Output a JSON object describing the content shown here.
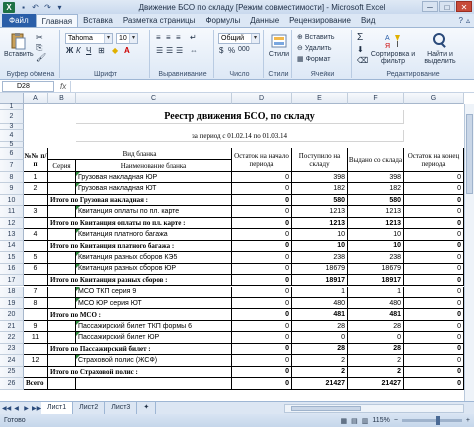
{
  "window": {
    "title": "Движение БСО по складу  [Режим совместимости]  -  Microsoft Excel",
    "app_icon": "X",
    "buttons": [
      "─",
      "□",
      "✕"
    ]
  },
  "ribbon_tabs": {
    "file": "Файл",
    "tabs": [
      "Главная",
      "Вставка",
      "Разметка страницы",
      "Формулы",
      "Данные",
      "Рецензирование",
      "Вид"
    ]
  },
  "ribbon": {
    "clipboard": {
      "paste": "Вставить",
      "label": "Буфер обмена"
    },
    "font": {
      "name": "Tahoma",
      "size": "10",
      "label": "Шрифт",
      "bold": "Ж",
      "italic": "К",
      "underline": "Ч"
    },
    "alignment": {
      "label": "Выравнивание"
    },
    "number": {
      "format": "Общий",
      "label": "Число",
      "percent": "%",
      "thousands": "000"
    },
    "styles": {
      "label": "Стили",
      "button": "Стили"
    },
    "cells": {
      "insert": "Вставить",
      "delete": "Удалить",
      "format": "Формат",
      "label": "Ячейки"
    },
    "editing": {
      "sum": "Σ",
      "sort": "Сортировка и фильтр",
      "find": "Найти и выделить",
      "label": "Редактирование"
    }
  },
  "formula_bar": {
    "name_box": "D28",
    "fx": "fx",
    "content": ""
  },
  "columns": [
    "A",
    "B",
    "C",
    "D",
    "E",
    "F",
    "G"
  ],
  "rows": [
    {
      "n": "1",
      "cells": []
    },
    {
      "n": "2",
      "cells": [
        {
          "col": "C",
          "span": 4,
          "text": "Реестр движения БСО, по складу",
          "cls": "bold c serif big"
        }
      ]
    },
    {
      "n": "3",
      "cells": []
    },
    {
      "n": "4",
      "cells": [
        {
          "col": "C",
          "span": 4,
          "text": "за период с 01.02.14 по 01.03.14",
          "cls": "c serif"
        }
      ]
    },
    {
      "n": "5",
      "cells": []
    },
    {
      "n": "6",
      "cells": []
    },
    {
      "n": "7",
      "cells": []
    },
    {
      "n": "8",
      "cells": [
        {
          "col": "A",
          "text": "1",
          "cls": "c"
        },
        {
          "col": "C",
          "text": "Грузовая накладная ЮР",
          "cls": "l",
          "tri": true
        },
        {
          "col": "D",
          "text": "0",
          "cls": "r"
        },
        {
          "col": "E",
          "text": "398",
          "cls": "r"
        },
        {
          "col": "F",
          "text": "398",
          "cls": "r"
        },
        {
          "col": "G",
          "text": "0",
          "cls": "r"
        }
      ]
    },
    {
      "n": "9",
      "cells": [
        {
          "col": "A",
          "text": "2",
          "cls": "c"
        },
        {
          "col": "C",
          "text": "Грузовая накладная ЮТ",
          "cls": "l",
          "tri": true
        },
        {
          "col": "D",
          "text": "0",
          "cls": "r"
        },
        {
          "col": "E",
          "text": "182",
          "cls": "r"
        },
        {
          "col": "F",
          "text": "182",
          "cls": "r"
        },
        {
          "col": "G",
          "text": "0",
          "cls": "r"
        }
      ]
    },
    {
      "n": "10",
      "cells": [
        {
          "col": "B",
          "span": 2,
          "text": "Итого по Грузовая накладная :",
          "cls": "bold l serif"
        },
        {
          "col": "D",
          "text": "0",
          "cls": "r bold"
        },
        {
          "col": "E",
          "text": "580",
          "cls": "r bold"
        },
        {
          "col": "F",
          "text": "580",
          "cls": "r bold"
        },
        {
          "col": "G",
          "text": "0",
          "cls": "r bold"
        }
      ]
    },
    {
      "n": "11",
      "cells": [
        {
          "col": "A",
          "text": "3",
          "cls": "c"
        },
        {
          "col": "C",
          "text": "Квитанция оплаты по пл. карте",
          "cls": "l",
          "tri": true
        },
        {
          "col": "D",
          "text": "0",
          "cls": "r"
        },
        {
          "col": "E",
          "text": "1213",
          "cls": "r"
        },
        {
          "col": "F",
          "text": "1213",
          "cls": "r"
        },
        {
          "col": "G",
          "text": "0",
          "cls": "r"
        }
      ]
    },
    {
      "n": "12",
      "cells": [
        {
          "col": "B",
          "span": 2,
          "text": "Итого по Квитанция оплаты по пл. карте :",
          "cls": "bold l serif"
        },
        {
          "col": "D",
          "text": "0",
          "cls": "r bold"
        },
        {
          "col": "E",
          "text": "1213",
          "cls": "r bold"
        },
        {
          "col": "F",
          "text": "1213",
          "cls": "r bold"
        },
        {
          "col": "G",
          "text": "0",
          "cls": "r bold"
        }
      ]
    },
    {
      "n": "13",
      "cells": [
        {
          "col": "A",
          "text": "4",
          "cls": "c"
        },
        {
          "col": "C",
          "text": "Квитанция платного багажа",
          "cls": "l",
          "tri": true
        },
        {
          "col": "D",
          "text": "0",
          "cls": "r"
        },
        {
          "col": "E",
          "text": "10",
          "cls": "r"
        },
        {
          "col": "F",
          "text": "10",
          "cls": "r"
        },
        {
          "col": "G",
          "text": "0",
          "cls": "r"
        }
      ]
    },
    {
      "n": "14",
      "cells": [
        {
          "col": "B",
          "span": 2,
          "text": "Итого по Квитанция платного багажа :",
          "cls": "bold l serif"
        },
        {
          "col": "D",
          "text": "0",
          "cls": "r bold"
        },
        {
          "col": "E",
          "text": "10",
          "cls": "r bold"
        },
        {
          "col": "F",
          "text": "10",
          "cls": "r bold"
        },
        {
          "col": "G",
          "text": "0",
          "cls": "r bold"
        }
      ]
    },
    {
      "n": "15",
      "cells": [
        {
          "col": "A",
          "text": "5",
          "cls": "c"
        },
        {
          "col": "C",
          "text": "Квитанция разных сборов КЭ5",
          "cls": "l",
          "tri": true
        },
        {
          "col": "D",
          "text": "0",
          "cls": "r"
        },
        {
          "col": "E",
          "text": "238",
          "cls": "r"
        },
        {
          "col": "F",
          "text": "238",
          "cls": "r"
        },
        {
          "col": "G",
          "text": "0",
          "cls": "r"
        }
      ]
    },
    {
      "n": "16",
      "cells": [
        {
          "col": "A",
          "text": "6",
          "cls": "c"
        },
        {
          "col": "C",
          "text": "Квитанция разных сборов ЮР",
          "cls": "l",
          "tri": true
        },
        {
          "col": "D",
          "text": "0",
          "cls": "r"
        },
        {
          "col": "E",
          "text": "18679",
          "cls": "r"
        },
        {
          "col": "F",
          "text": "18679",
          "cls": "r"
        },
        {
          "col": "G",
          "text": "0",
          "cls": "r"
        }
      ]
    },
    {
      "n": "17",
      "cells": [
        {
          "col": "B",
          "span": 2,
          "text": "Итого по Квитанция разных сборов :",
          "cls": "bold l serif"
        },
        {
          "col": "D",
          "text": "0",
          "cls": "r bold"
        },
        {
          "col": "E",
          "text": "18917",
          "cls": "r bold"
        },
        {
          "col": "F",
          "text": "18917",
          "cls": "r bold"
        },
        {
          "col": "G",
          "text": "0",
          "cls": "r bold"
        }
      ]
    },
    {
      "n": "18",
      "cells": [
        {
          "col": "A",
          "text": "7",
          "cls": "c"
        },
        {
          "col": "C",
          "text": "МСО ТКП серия 9",
          "cls": "l",
          "tri": true
        },
        {
          "col": "D",
          "text": "0",
          "cls": "r"
        },
        {
          "col": "E",
          "text": "1",
          "cls": "r"
        },
        {
          "col": "F",
          "text": "1",
          "cls": "r"
        },
        {
          "col": "G",
          "text": "0",
          "cls": "r"
        }
      ]
    },
    {
      "n": "19",
      "cells": [
        {
          "col": "A",
          "text": "8",
          "cls": "c"
        },
        {
          "col": "C",
          "text": "МСО ЮР серия ЮТ",
          "cls": "l",
          "tri": true
        },
        {
          "col": "D",
          "text": "0",
          "cls": "r"
        },
        {
          "col": "E",
          "text": "480",
          "cls": "r"
        },
        {
          "col": "F",
          "text": "480",
          "cls": "r"
        },
        {
          "col": "G",
          "text": "0",
          "cls": "r"
        }
      ]
    },
    {
      "n": "20",
      "cells": [
        {
          "col": "B",
          "span": 2,
          "text": "Итого по МСО :",
          "cls": "bold l serif"
        },
        {
          "col": "D",
          "text": "0",
          "cls": "r bold"
        },
        {
          "col": "E",
          "text": "481",
          "cls": "r bold"
        },
        {
          "col": "F",
          "text": "481",
          "cls": "r bold"
        },
        {
          "col": "G",
          "text": "0",
          "cls": "r bold"
        }
      ]
    },
    {
      "n": "21",
      "cells": [
        {
          "col": "A",
          "text": "9",
          "cls": "c"
        },
        {
          "col": "C",
          "text": "Пассажирский билет ТКП формы 6",
          "cls": "l",
          "tri": true
        },
        {
          "col": "D",
          "text": "0",
          "cls": "r"
        },
        {
          "col": "E",
          "text": "28",
          "cls": "r"
        },
        {
          "col": "F",
          "text": "28",
          "cls": "r"
        },
        {
          "col": "G",
          "text": "0",
          "cls": "r"
        }
      ]
    },
    {
      "n": "22",
      "cells": [
        {
          "col": "A",
          "text": "11",
          "cls": "c"
        },
        {
          "col": "C",
          "text": "Пассажирский билет ЮР",
          "cls": "l",
          "tri": true
        },
        {
          "col": "D",
          "text": "0",
          "cls": "r"
        },
        {
          "col": "E",
          "text": "0",
          "cls": "r"
        },
        {
          "col": "F",
          "text": "0",
          "cls": "r"
        },
        {
          "col": "G",
          "text": "0",
          "cls": "r"
        }
      ]
    },
    {
      "n": "23",
      "cells": [
        {
          "col": "B",
          "span": 2,
          "text": "Итого по Пассажирский билет :",
          "cls": "bold l serif"
        },
        {
          "col": "D",
          "text": "0",
          "cls": "r bold"
        },
        {
          "col": "E",
          "text": "28",
          "cls": "r bold"
        },
        {
          "col": "F",
          "text": "28",
          "cls": "r bold"
        },
        {
          "col": "G",
          "text": "0",
          "cls": "r bold"
        }
      ]
    },
    {
      "n": "24",
      "cells": [
        {
          "col": "A",
          "text": "12",
          "cls": "c"
        },
        {
          "col": "C",
          "text": "Страховой полис (ЖСФ)",
          "cls": "l",
          "tri": true
        },
        {
          "col": "D",
          "text": "0",
          "cls": "r"
        },
        {
          "col": "E",
          "text": "2",
          "cls": "r"
        },
        {
          "col": "F",
          "text": "2",
          "cls": "r"
        },
        {
          "col": "G",
          "text": "0",
          "cls": "r"
        }
      ]
    },
    {
      "n": "25",
      "cells": [
        {
          "col": "B",
          "span": 2,
          "text": "Итого по Страховой полис :",
          "cls": "bold l serif"
        },
        {
          "col": "D",
          "text": "0",
          "cls": "r bold"
        },
        {
          "col": "E",
          "text": "2",
          "cls": "r bold"
        },
        {
          "col": "F",
          "text": "2",
          "cls": "r bold"
        },
        {
          "col": "G",
          "text": "0",
          "cls": "r bold"
        }
      ]
    },
    {
      "n": "26",
      "cells": [
        {
          "col": "A",
          "span": 1,
          "text": "Всего",
          "cls": "bold l serif"
        },
        {
          "col": "D",
          "text": "0",
          "cls": "r bold"
        },
        {
          "col": "E",
          "text": "21427",
          "cls": "r bold"
        },
        {
          "col": "F",
          "text": "21427",
          "cls": "r bold"
        },
        {
          "col": "G",
          "text": "0",
          "cls": "r bold"
        }
      ]
    }
  ],
  "header_table": {
    "num": "№№ п/п",
    "type": "Вид бланка",
    "series": "Серия",
    "name": "Наименование бланка",
    "start": "Остаток на начало периода",
    "received": "Поступило на складу",
    "issued": "Выдано со склада",
    "end": "Остаток на конец периода"
  },
  "sheets": [
    "Лист1",
    "Лист2",
    "Лист3"
  ],
  "status": {
    "ready": "Готово",
    "zoom": "115%"
  }
}
